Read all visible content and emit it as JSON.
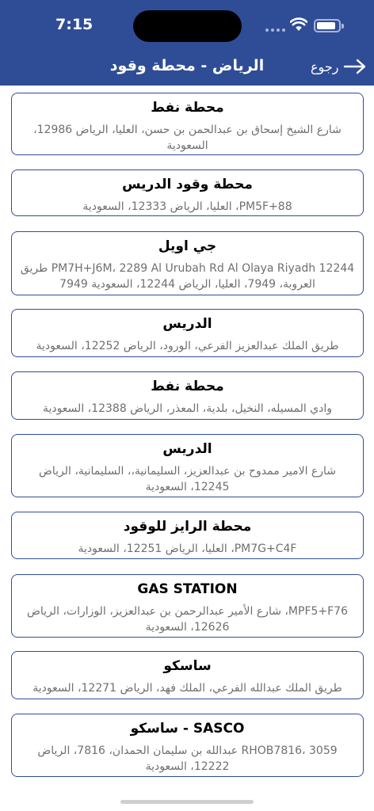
{
  "status_bar": {
    "time": "7:15",
    "battery_level": 0.9
  },
  "header": {
    "title": "الرياض - محطة وقود",
    "back_label": "رجوع"
  },
  "stations": [
    {
      "name": "محطة نفط",
      "address": "شارع الشيخ إسحاق بن عبدالحمن بن حسن، العليا، الرياض 12986، السعودية"
    },
    {
      "name": "محطة وقود الدريس",
      "address": "PM5F+88، العليا، الرياض 12333، السعودية"
    },
    {
      "name": "جي اويل",
      "address": "PM7H+J6M، 2289 Al Urubah Rd Al Olaya Riyadh 12244 طريق العروبة، 7949، العليا، الرياض 12244، السعودية 7949"
    },
    {
      "name": "الدريس",
      "address": "طريق الملك عبدالعزيز الفرعي، الورود، الرياض 12252، السعودية"
    },
    {
      "name": "محطة نفط",
      "address": "وادي المسيله، النخيل، بلدية، المعذر، الرياض 12388، السعودية"
    },
    {
      "name": "الدريس",
      "address": "شارع الامير ممدوح بن عبدالعزيز، السليمانية،، السليمانية، الرياض 12245، السعودية"
    },
    {
      "name": "محطة الرايز للوقود",
      "address": "PM7G+C4F، العليا، الرياض 12251، السعودية"
    },
    {
      "name": "GAS STATION",
      "address": "MPF5+F76، شارع الأمير عبدالرحمن بن عبدالعزيز، الوزارات، الرياض 12626، السعودية"
    },
    {
      "name": "ساسكو",
      "address": "طريق الملك عبدالله الفرعي، الملك فهد، الرياض 12271، السعودية"
    },
    {
      "name": "SASCO - ساسكو",
      "address": "RHOB7816، 3059 عبدالله بن سليمان الحمدان، 7816، الرياض 12222، السعودية"
    }
  ]
}
